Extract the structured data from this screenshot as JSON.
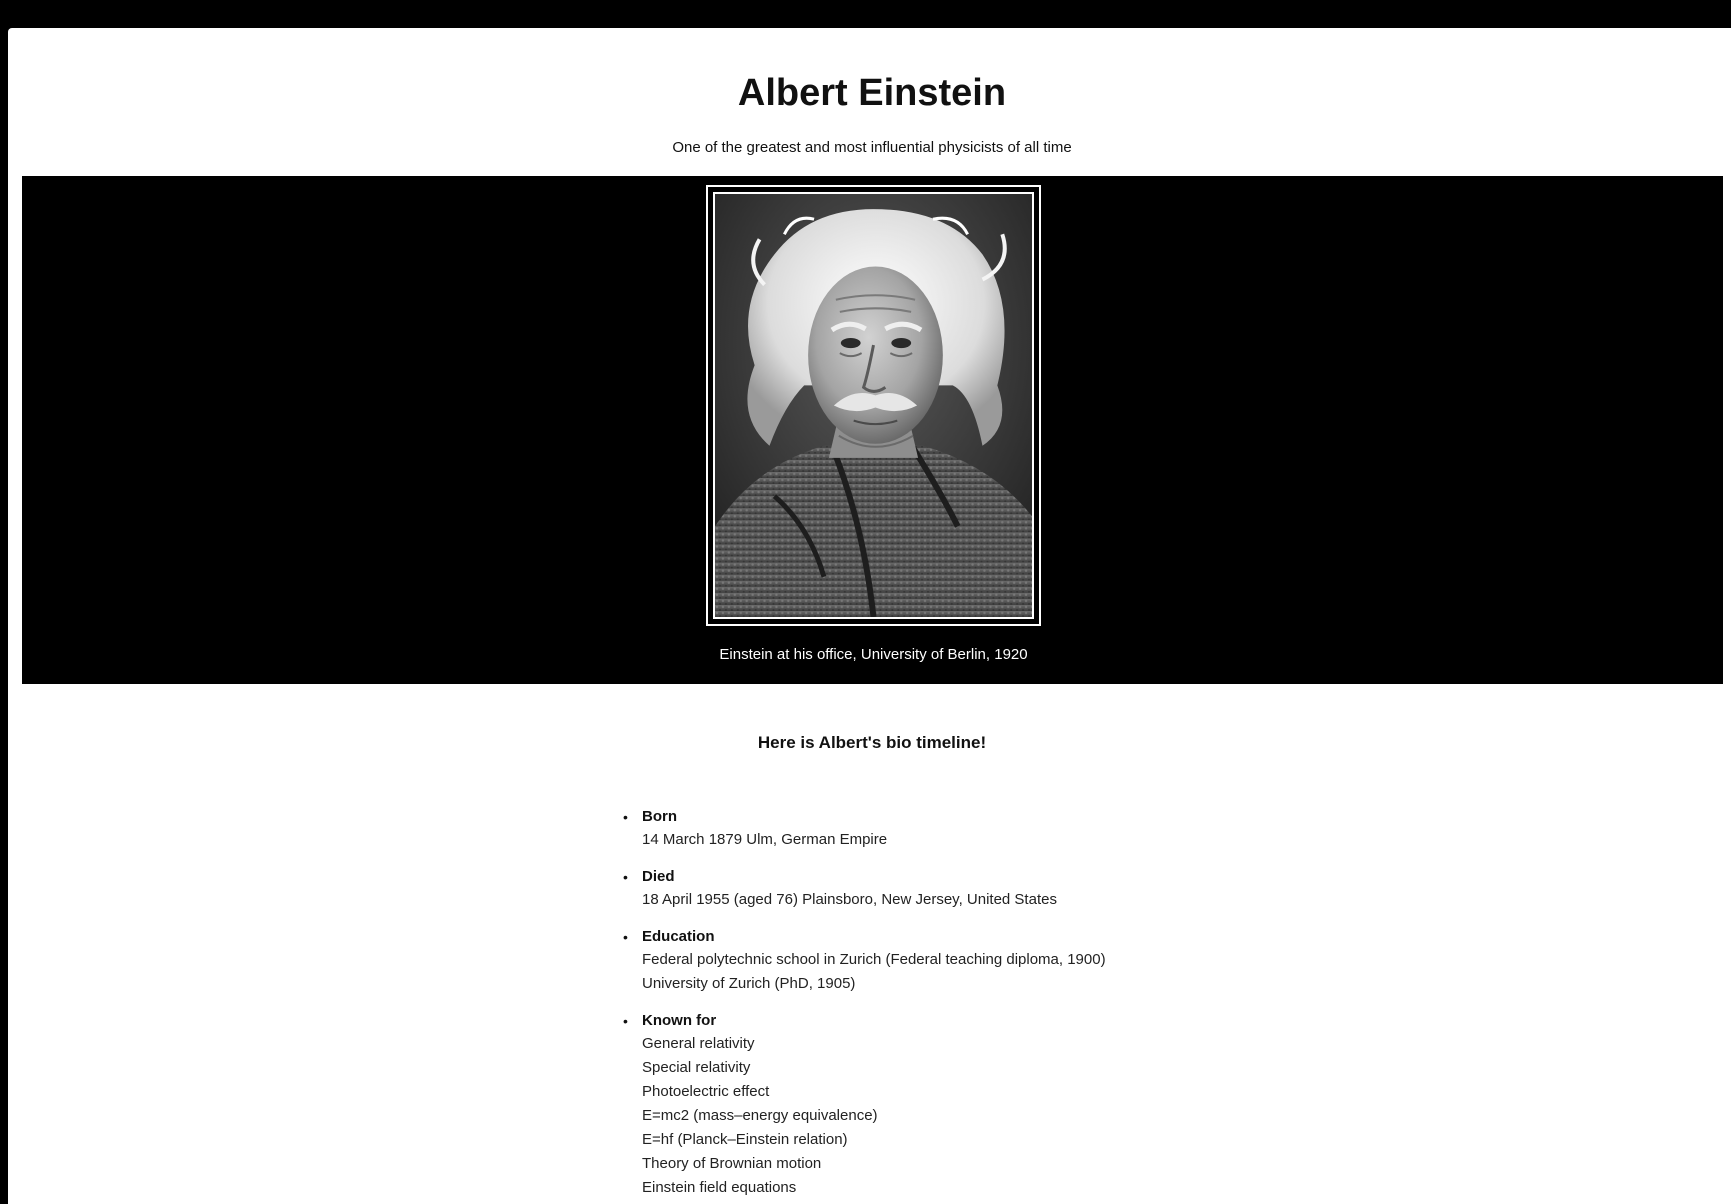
{
  "page": {
    "title": "Albert Einstein",
    "subtitle": "One of the greatest and most influential physicists of all time"
  },
  "hero": {
    "image_alt": "Portrait of Albert Einstein",
    "caption": "Einstein at his office, University of Berlin, 1920"
  },
  "timeline": {
    "heading": "Here is Albert's bio timeline!",
    "items": [
      {
        "label": "Born",
        "lines": [
          "14 March 1879 Ulm, German Empire"
        ]
      },
      {
        "label": "Died",
        "lines": [
          "18 April 1955 (aged 76) Plainsboro, New Jersey, United States"
        ]
      },
      {
        "label": "Education",
        "lines": [
          "Federal polytechnic school in Zurich (Federal teaching diploma, 1900)",
          "University of Zurich (PhD, 1905)"
        ]
      },
      {
        "label": "Known for",
        "lines": [
          "General relativity",
          "Special relativity",
          "Photoelectric effect",
          "E=mc2 (mass–energy equivalence)",
          "E=hf (Planck–Einstein relation)",
          "Theory of Brownian motion",
          "Einstein field equations"
        ]
      }
    ]
  },
  "colors": {
    "hero_background": "#000000",
    "page_background": "#ffffff",
    "text": "#111111",
    "frame": "#ffffff"
  }
}
